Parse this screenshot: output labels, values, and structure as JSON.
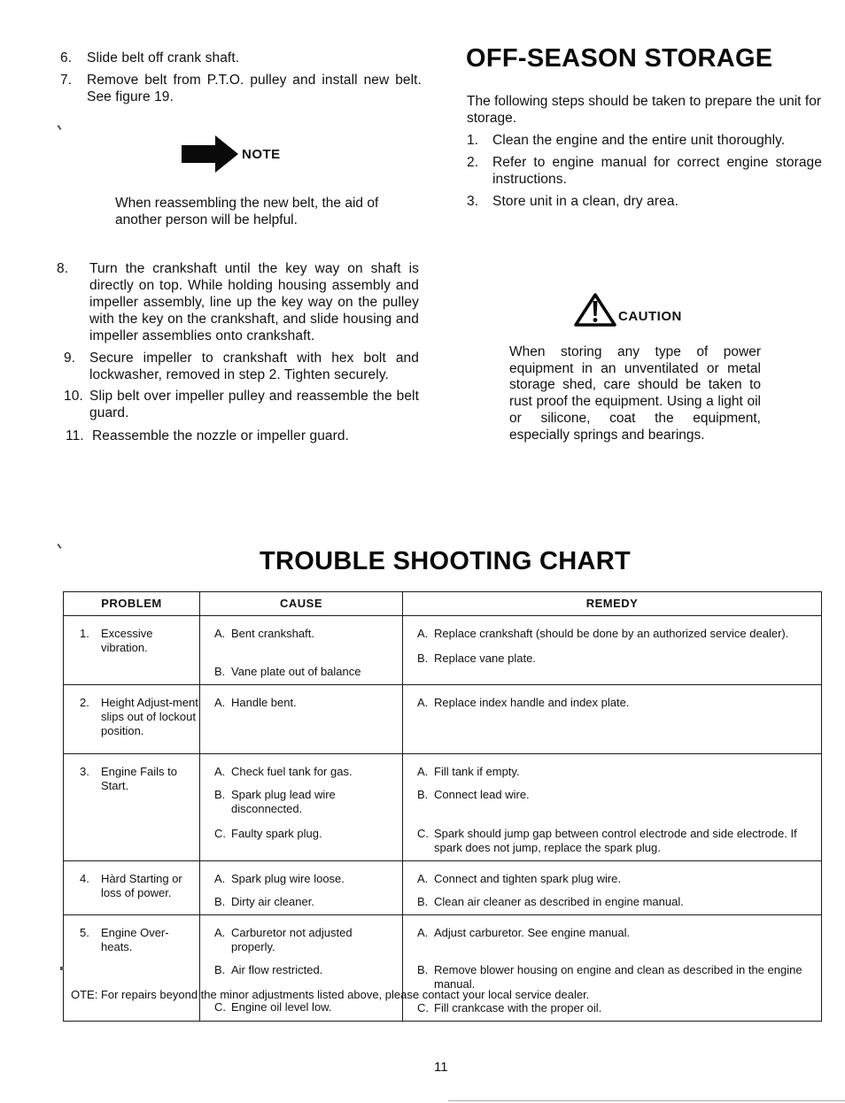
{
  "left_column": {
    "steps_top": [
      {
        "num": "6.",
        "text": "Slide belt off crank shaft."
      },
      {
        "num": "7.",
        "text": "Remove belt from P.T.O. pulley and install new belt. See figure 19."
      }
    ],
    "note": {
      "icon": "arrow-right-icon",
      "label": "NOTE",
      "text": "When reassembling the new belt, the aid of another person will be helpful."
    },
    "steps_bottom": [
      {
        "num": "8.",
        "text": "Turn the crankshaft until the key way on shaft is directly on top. While holding housing assembly and impeller assembly, line up the key way on the pulley with the key on the crankshaft, and slide housing and impeller assemblies onto crankshaft."
      },
      {
        "num": "9.",
        "text": "Secure impeller to crankshaft with hex bolt and lockwasher, removed in step 2. Tighten securely."
      },
      {
        "num": "10.",
        "text": "Slip belt over impeller pulley and reassemble the belt guard."
      },
      {
        "num": "11.",
        "text": "Reassemble the nozzle or impeller guard."
      }
    ]
  },
  "off_season": {
    "title": "OFF-SEASON STORAGE",
    "intro": "The following steps should be taken to prepare the unit for storage.",
    "steps": [
      {
        "num": "1.",
        "text": "Clean the engine and the entire unit thoroughly."
      },
      {
        "num": "2.",
        "text": "Refer to engine manual for correct engine storage instructions."
      },
      {
        "num": "3.",
        "text": "Store unit in a clean, dry area."
      }
    ],
    "caution": {
      "icon": "warning-triangle-icon",
      "label": "CAUTION",
      "text": "When storing any type of power equipment in an unventilated or metal storage shed, care should be taken to rust proof the equipment. Using a light oil or silicone, coat the equipment, especially springs and bearings."
    }
  },
  "trouble_chart": {
    "title": "TROUBLE SHOOTING CHART",
    "headers": {
      "problem": "PROBLEM",
      "cause": "CAUSE",
      "remedy": "REMEDY"
    },
    "rows": [
      {
        "num": "1.",
        "problem": "Excessive vibration.",
        "causes": [
          {
            "letter": "A.",
            "text": "Bent crankshaft."
          },
          {
            "letter": "B.",
            "text": "Vane plate out of balance"
          }
        ],
        "remedies": [
          {
            "letter": "A.",
            "text": "Replace crankshaft (should be done by an authorized service dealer)."
          },
          {
            "letter": "B.",
            "text": "Replace vane plate."
          }
        ]
      },
      {
        "num": "2.",
        "problem": "Height Adjust-ment slips out of lockout position.",
        "causes": [
          {
            "letter": "A.",
            "text": "Handle bent."
          }
        ],
        "remedies": [
          {
            "letter": "A.",
            "text": "Replace index handle and index plate."
          }
        ]
      },
      {
        "num": "3.",
        "problem": "Engine Fails to Start.",
        "causes": [
          {
            "letter": "A.",
            "text": "Check fuel tank for gas."
          },
          {
            "letter": "B.",
            "text": "Spark plug lead wire disconnected."
          },
          {
            "letter": "C.",
            "text": "Faulty spark plug."
          }
        ],
        "remedies": [
          {
            "letter": "A.",
            "text": "Fill tank if empty."
          },
          {
            "letter": "B.",
            "text": "Connect lead wire."
          },
          {
            "letter": "C.",
            "text": "Spark should jump gap between control electrode and side electrode. If spark does not jump, replace the spark plug."
          }
        ]
      },
      {
        "num": "4.",
        "problem": "Hàrd Starting or loss of power.",
        "causes": [
          {
            "letter": "A.",
            "text": "Spark plug wire loose."
          },
          {
            "letter": "B.",
            "text": "Dirty air cleaner."
          }
        ],
        "remedies": [
          {
            "letter": "A.",
            "text": "Connect and tighten spark plug wire."
          },
          {
            "letter": "B.",
            "text": "Clean air cleaner as described in engine manual."
          }
        ]
      },
      {
        "num": "5.",
        "problem": "Engine Over-heats.",
        "causes": [
          {
            "letter": "A.",
            "text": "Carburetor not adjusted properly."
          },
          {
            "letter": "B.",
            "text": "Air flow restricted."
          },
          {
            "letter": "C.",
            "text": "Engine oil level low."
          }
        ],
        "remedies": [
          {
            "letter": "A.",
            "text": "Adjust carburetor. See engine manual."
          },
          {
            "letter": "B.",
            "text": "Remove blower housing on engine and clean as described in the engine manual."
          },
          {
            "letter": "C.",
            "text": "Fill crankcase with the proper oil."
          }
        ]
      }
    ],
    "footnote": "OTE: For repairs beyond the minor adjustments listed above, please contact your local service dealer."
  },
  "page_number": "11"
}
